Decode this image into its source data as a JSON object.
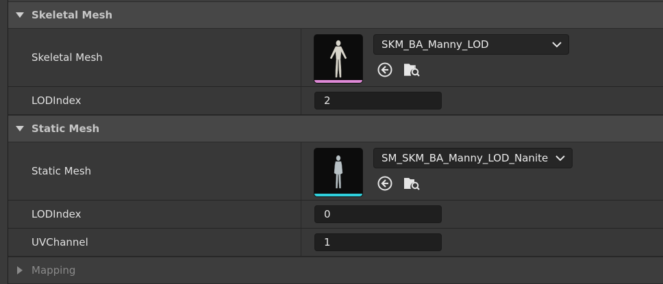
{
  "sections": {
    "skeletal": {
      "title": "Skeletal Mesh",
      "mesh_label": "Skeletal Mesh",
      "asset_name": "SKM_BA_Manny_LOD",
      "asset_bar_color": "#e08ad8",
      "lod_label": "LODIndex",
      "lod_value": "2"
    },
    "static": {
      "title": "Static Mesh",
      "mesh_label": "Static Mesh",
      "asset_name": "SM_SKM_BA_Manny_LOD_Nanite",
      "asset_bar_color": "#2fd0dc",
      "lod_label": "LODIndex",
      "lod_value": "0",
      "uv_label": "UVChannel",
      "uv_value": "1"
    },
    "mapping": {
      "title": "Mapping"
    }
  },
  "icons": {
    "use_selected": "use-selected-arrow-icon",
    "browse": "browse-folder-search-icon",
    "expanded": "triangle-down-icon",
    "collapsed": "triangle-right-icon",
    "dropdown": "chevron-down-icon"
  },
  "colors": {
    "panel_bg": "#383838",
    "category_bg": "#474747",
    "field_bg": "#1f1f1f",
    "combo_bg": "#262626"
  }
}
